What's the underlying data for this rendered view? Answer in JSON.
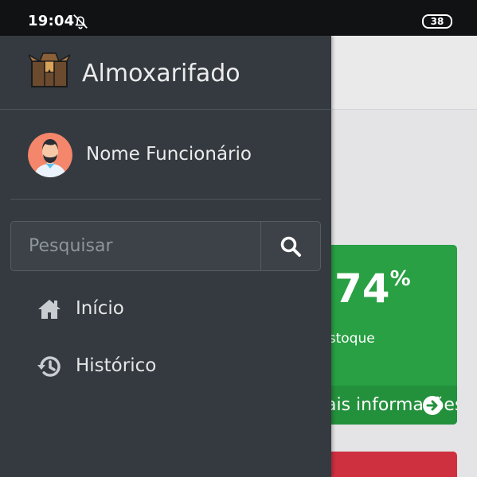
{
  "status_bar": {
    "time": "19:04",
    "battery": "38"
  },
  "drawer": {
    "app_title": "Almoxarifado",
    "user_name": "Nome Funcionário",
    "search": {
      "placeholder": "Pesquisar"
    },
    "nav": [
      {
        "label": "Início",
        "icon": "home-icon"
      },
      {
        "label": "Histórico",
        "icon": "history-icon"
      }
    ]
  },
  "background": {
    "stat_card": {
      "value": "74",
      "unit": "%",
      "label": "Estoque",
      "more_link": "Mais informações",
      "color": "#28a043"
    },
    "alert_card_color": "#cf3040"
  },
  "colors": {
    "drawer_bg": "#343a40",
    "status_bar_bg": "#111214"
  }
}
